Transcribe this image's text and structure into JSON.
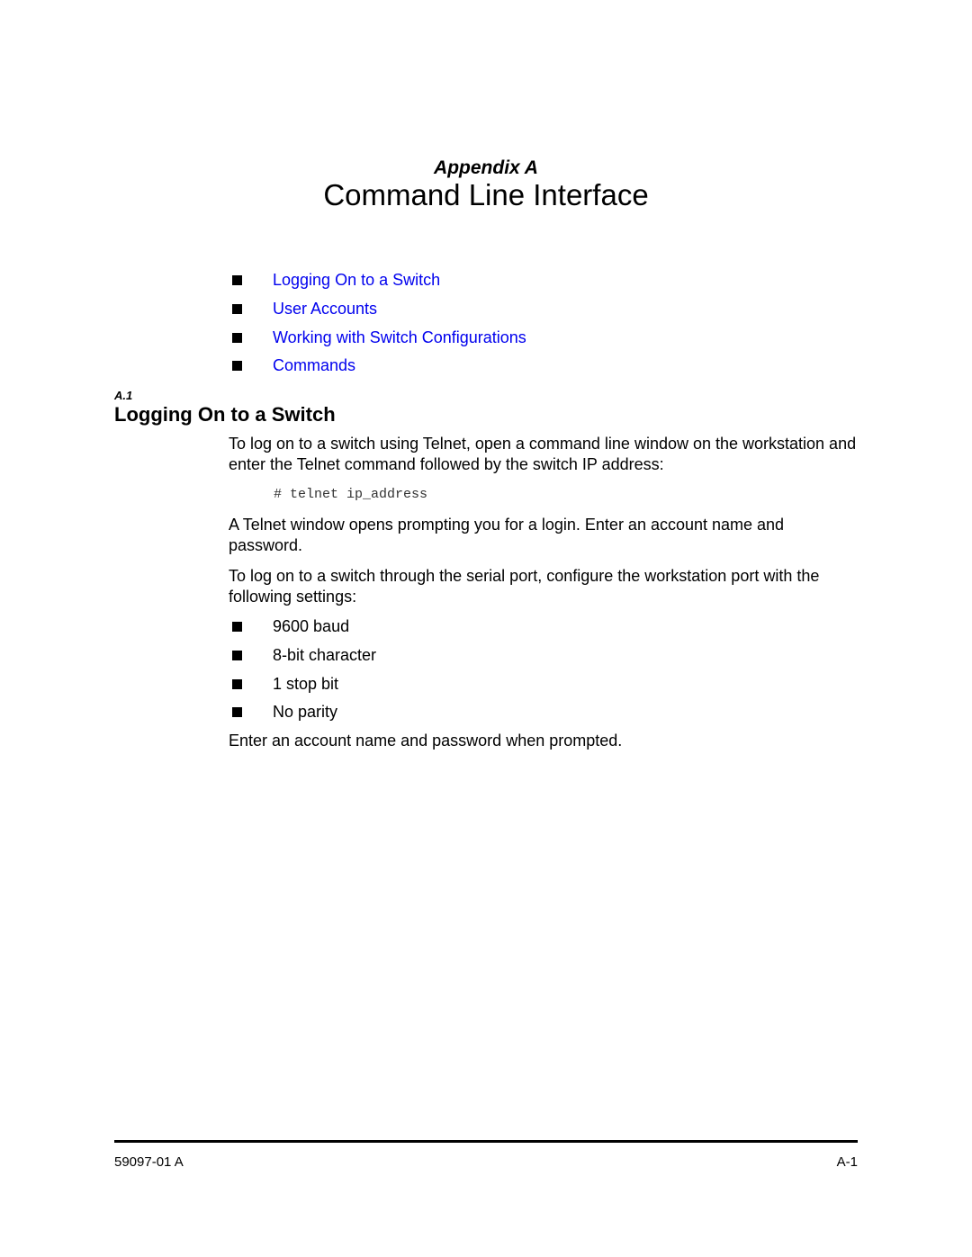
{
  "header": {
    "appendix_label": "Appendix A",
    "chapter_title": "Command Line Interface"
  },
  "toc": {
    "items": [
      {
        "label": "Logging On to a Switch",
        "icon": "square-bullet"
      },
      {
        "label": "User Accounts",
        "icon": "square-bullet"
      },
      {
        "label": "Working with Switch Configurations",
        "icon": "square-bullet"
      },
      {
        "label": "Commands",
        "icon": "square-bullet"
      }
    ],
    "link_color": "#0000ee"
  },
  "section": {
    "number": "A.1",
    "title": "Logging On to a Switch",
    "para1": "To log on to a switch using Telnet, open a command line window on the workstation and enter the Telnet command followed by the switch IP address:",
    "code": "# telnet ip_address",
    "para2": "A Telnet window opens prompting you for a login. Enter an account name and password.",
    "para3": "To log on to a switch through the serial port, configure the workstation port with the following settings:",
    "settings": [
      "9600 baud",
      "8-bit character",
      "1 stop bit",
      "No parity"
    ],
    "para4": "Enter an account name and password when prompted."
  },
  "footer": {
    "doc_number": "59097-01 A",
    "page_number": "A-1"
  }
}
